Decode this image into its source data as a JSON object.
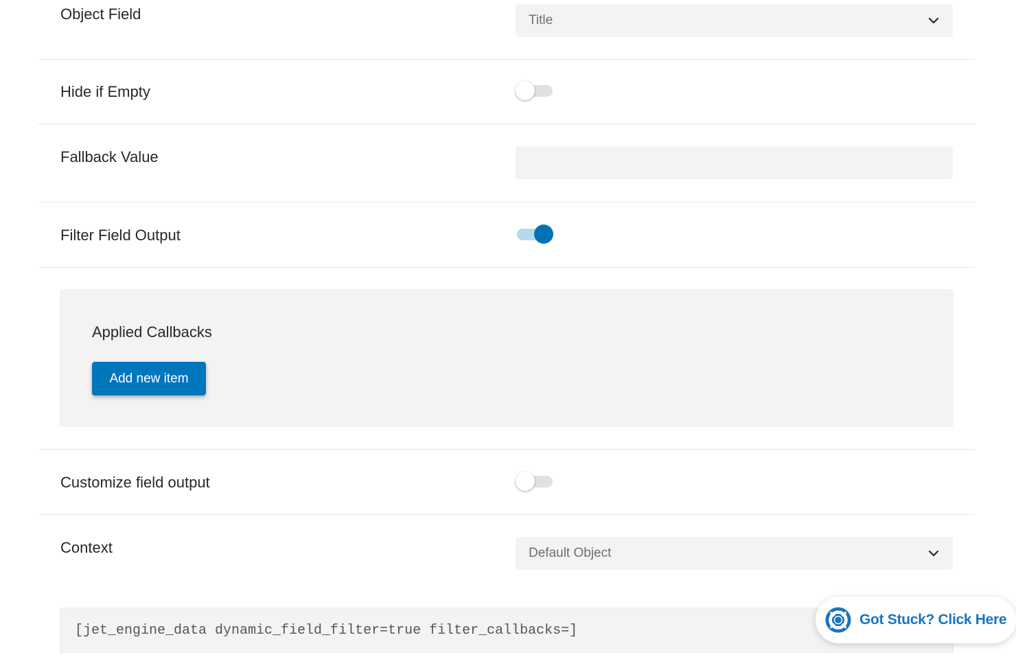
{
  "fields": {
    "object_field": {
      "label": "Object Field",
      "value": "Title"
    },
    "hide_if_empty": {
      "label": "Hide if Empty",
      "enabled": false
    },
    "fallback_value": {
      "label": "Fallback Value",
      "value": ""
    },
    "filter_field_output": {
      "label": "Filter Field Output",
      "enabled": true
    },
    "customize_field_output": {
      "label": "Customize field output",
      "enabled": false
    },
    "context": {
      "label": "Context",
      "value": "Default Object"
    }
  },
  "callbacks": {
    "title": "Applied Callbacks",
    "add_button_label": "Add new item"
  },
  "shortcode": "[jet_engine_data dynamic_field_filter=true filter_callbacks=]",
  "help": {
    "label": "Got Stuck? Click Here",
    "icon": "lifebuoy-icon"
  },
  "colors": {
    "accent": "#0076bd",
    "toggle_on_track": "#b6d9ec",
    "help_text": "#1b74bb"
  }
}
